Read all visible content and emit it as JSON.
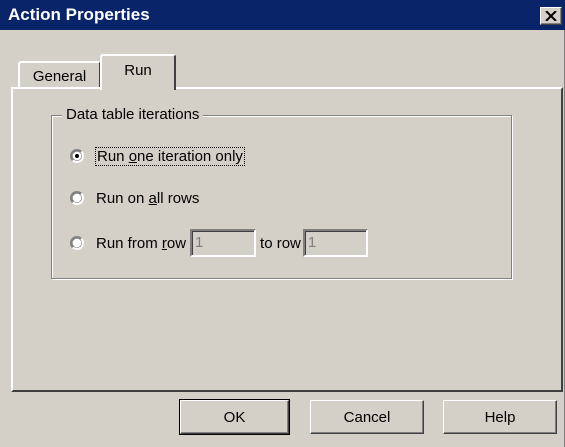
{
  "window": {
    "title": "Action Properties",
    "close_icon": "close-x-icon"
  },
  "tabs": [
    {
      "label": "General",
      "selected": false
    },
    {
      "label": "Run",
      "selected": true
    }
  ],
  "group": {
    "label": "Data table iterations",
    "options": [
      {
        "pre": "Run ",
        "accel": "o",
        "post": "ne iteration only",
        "checked": true
      },
      {
        "pre": "Run on ",
        "accel": "a",
        "post": "ll rows",
        "checked": false
      },
      {
        "pre": "Run from ",
        "accel": "r",
        "post": "ow",
        "checked": false
      }
    ],
    "from_row_value": "1",
    "to_row_label": "to row",
    "to_row_value": "1"
  },
  "buttons": {
    "ok": "OK",
    "cancel": "Cancel",
    "help": "Help"
  }
}
